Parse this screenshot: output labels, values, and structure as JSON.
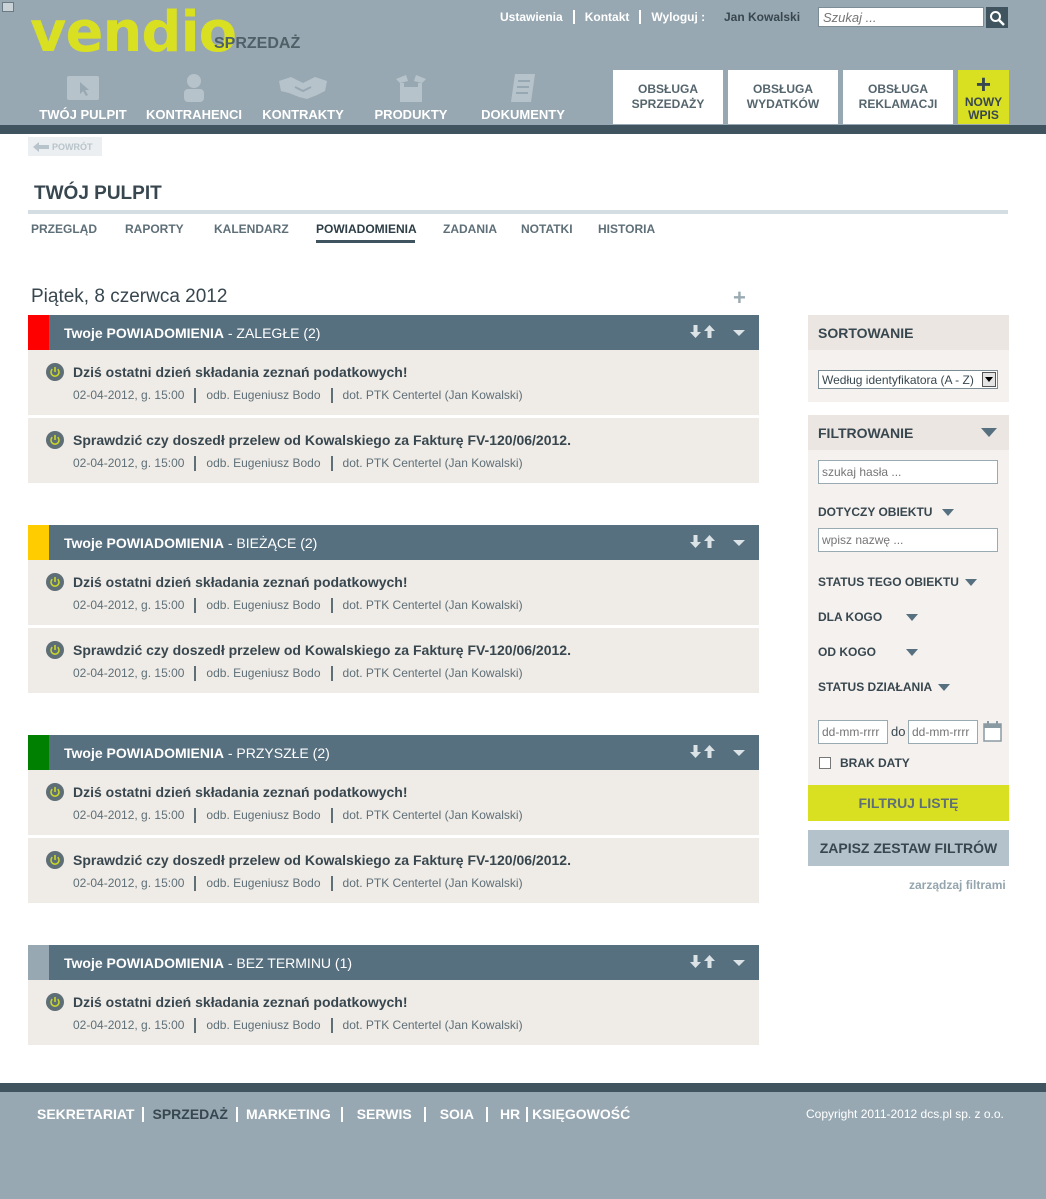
{
  "header": {
    "logo": "vendio",
    "module": "SPRZEDAŻ",
    "links": [
      "Ustawienia",
      "Kontakt",
      "Wyloguj :"
    ],
    "user": "Jan Kowalski",
    "search_placeholder": "Szukaj ...",
    "nav": [
      {
        "label": "TWÓJ PULPIT",
        "icon": "desktop-icon"
      },
      {
        "label": "KONTRAHENCI",
        "icon": "person-icon"
      },
      {
        "label": "KONTRAKTY",
        "icon": "handshake-icon"
      },
      {
        "label": "PRODUKTY",
        "icon": "box-icon"
      },
      {
        "label": "DOKUMENTY",
        "icon": "document-icon"
      }
    ],
    "actions": [
      {
        "line1": "OBSŁUGA",
        "line2": "SPRZEDAŻY"
      },
      {
        "line1": "OBSŁUGA",
        "line2": "WYDATKÓW"
      },
      {
        "line1": "OBSŁUGA",
        "line2": "REKLAMACJI"
      }
    ],
    "new_entry": {
      "line1": "NOWY",
      "line2": "WPIS"
    }
  },
  "back_label": "POWRÓT",
  "page_title": "TWÓJ PULPIT",
  "tabs": [
    {
      "label": "PRZEGLĄD",
      "active": false
    },
    {
      "label": "RAPORTY",
      "active": false
    },
    {
      "label": "KALENDARZ",
      "active": false
    },
    {
      "label": "POWIADOMIENIA",
      "active": true
    },
    {
      "label": "ZADANIA",
      "active": false
    },
    {
      "label": "NOTATKI",
      "active": false
    },
    {
      "label": "HISTORIA",
      "active": false
    }
  ],
  "date_heading": "Piątek, 8 czerwca 2012",
  "groups": [
    {
      "prefix": "Twoje POWIADOMIENIA",
      "suffix": " - ZALEGŁE (2)",
      "marker_color": "#ff0000",
      "items": [
        {
          "text": "Dziś ostatni dzień składania zeznań podatkowych!",
          "date": "02-04-2012, g. 15:00",
          "to": "odb. Eugeniusz Bodo",
          "about": "dot. PTK Centertel (Jan Kowalski)"
        },
        {
          "text": "Sprawdzić czy doszedł przelew od Kowalskiego za Fakturę FV-120/06/2012.",
          "date": "02-04-2012, g. 15:00",
          "to": "odb. Eugeniusz Bodo",
          "about": "dot. PTK Centertel (Jan Kowalski)"
        }
      ]
    },
    {
      "prefix": "Twoje POWIADOMIENIA",
      "suffix": " - BIEŻĄCE (2)",
      "marker_color": "#ffcc00",
      "items": [
        {
          "text": "Dziś ostatni dzień składania zeznań podatkowych!",
          "date": "02-04-2012, g. 15:00",
          "to": "odb. Eugeniusz Bodo",
          "about": "dot. PTK Centertel (Jan Kowalski)"
        },
        {
          "text": "Sprawdzić czy doszedł przelew od Kowalskiego za Fakturę FV-120/06/2012.",
          "date": "02-04-2012, g. 15:00",
          "to": "odb. Eugeniusz Bodo",
          "about": "dot. PTK Centertel (Jan Kowalski)"
        }
      ]
    },
    {
      "prefix": "Twoje POWIADOMIENIA",
      "suffix": " - PRZYSZŁE (2)",
      "marker_color": "#008000",
      "items": [
        {
          "text": "Dziś ostatni dzień składania zeznań podatkowych!",
          "date": "02-04-2012, g. 15:00",
          "to": "odb. Eugeniusz Bodo",
          "about": "dot. PTK Centertel (Jan Kowalski)"
        },
        {
          "text": "Sprawdzić czy doszedł przelew od Kowalskiego za Fakturę FV-120/06/2012.",
          "date": "02-04-2012, g. 15:00",
          "to": "odb. Eugeniusz Bodo",
          "about": "dot. PTK Centertel (Jan Kowalski)"
        }
      ]
    },
    {
      "prefix": "Twoje POWIADOMIENIA",
      "suffix": " - BEZ TERMINU (1)",
      "marker_color": "#98a8b2",
      "items": [
        {
          "text": "Dziś ostatni dzień składania zeznań podatkowych!",
          "date": "02-04-2012, g. 15:00",
          "to": "odb. Eugeniusz Bodo",
          "about": "dot. PTK Centertel (Jan Kowalski)"
        }
      ]
    }
  ],
  "sidebar": {
    "sort_title": "SORTOWANIE",
    "sort_value": "Według identyfikatora (A - Z)",
    "filter_title": "FILTROWANIE",
    "search_placeholder": "szukaj hasła ...",
    "object_label": "DOTYCZY OBIEKTU",
    "object_placeholder": "wpisz nazwę ...",
    "status_object_label": "STATUS TEGO OBIEKTU",
    "for_whom_label": "DLA KOGO",
    "from_whom_label": "OD KOGO",
    "action_status_label": "STATUS DZIAŁANIA",
    "date_from_placeholder": "dd-mm-rrrr",
    "date_to_label": "do",
    "date_to_placeholder": "dd-mm-rrrr",
    "no_date_label": "BRAK DATY",
    "filter_button": "FILTRUJ LISTĘ",
    "save_button": "ZAPISZ ZESTAW FILTRÓW",
    "manage_link": "zarządzaj filtrami"
  },
  "footer": {
    "links": [
      "SEKRETARIAT",
      "SPRZEDAŻ",
      "MARKETING",
      "SERWIS",
      "SOIA",
      "HR",
      "KSIĘGOWOŚĆ"
    ],
    "current": "SPRZEDAŻ",
    "copyright": "Copyright 2011-2012 dcs.pl sp. z o.o."
  },
  "colors": {
    "header_bg": "#98a8b2",
    "header_strip": "#3f545e",
    "accent_lime": "#d9e021",
    "group_head": "#577080",
    "item_bg": "#efebe6"
  }
}
